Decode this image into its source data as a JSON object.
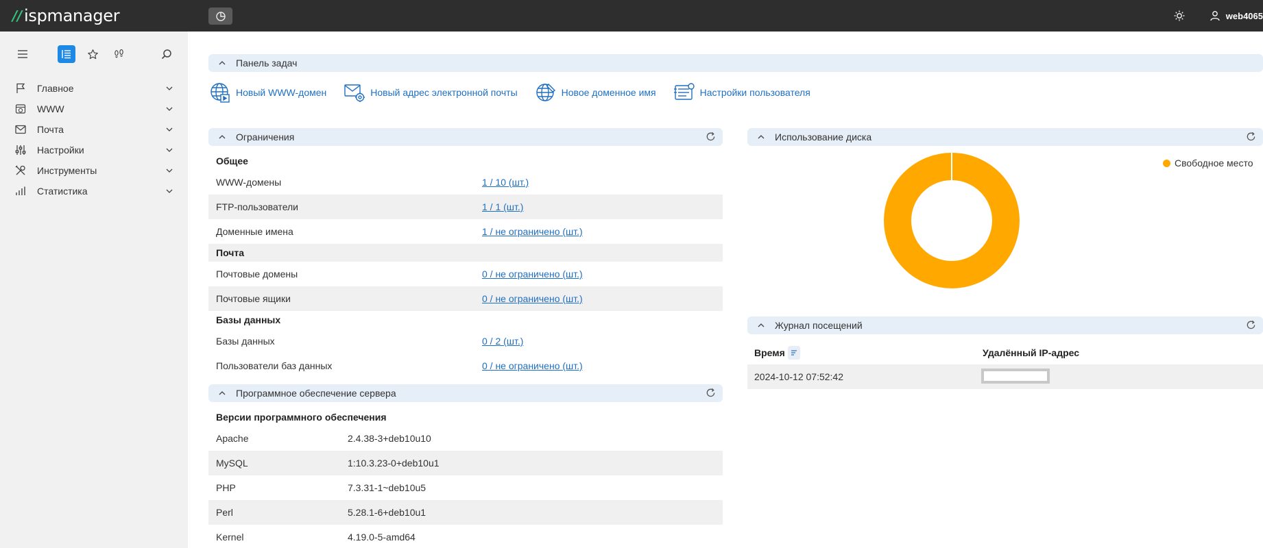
{
  "app": {
    "logo_text": "ispmanager"
  },
  "topbar": {
    "user": "web4065",
    "icons": [
      "dashboard-icon",
      "sun-icon",
      "user-icon"
    ]
  },
  "sidebar": {
    "tools": [
      "hamburger-icon",
      "list-icon",
      "star-icon",
      "footprints-icon",
      "search-icon"
    ],
    "items": [
      {
        "label": "Главное",
        "icon": "flag-icon"
      },
      {
        "label": "WWW",
        "icon": "www-icon"
      },
      {
        "label": "Почта",
        "icon": "mail-icon"
      },
      {
        "label": "Настройки",
        "icon": "sliders-icon"
      },
      {
        "label": "Инструменты",
        "icon": "tools-icon"
      },
      {
        "label": "Статистика",
        "icon": "chart-icon"
      }
    ]
  },
  "tasks": {
    "title": "Панель задач",
    "items": [
      {
        "label": "Новый WWW-домен",
        "icon": "www-domain-icon"
      },
      {
        "label": "Новый адрес электронной почты",
        "icon": "email-settings-icon"
      },
      {
        "label": "Новое доменное имя",
        "icon": "domain-name-icon"
      },
      {
        "label": "Настройки пользователя",
        "icon": "user-settings-icon"
      }
    ]
  },
  "limits": {
    "title": "Ограничения",
    "groups": [
      {
        "name": "Общее",
        "rows": [
          {
            "label": "WWW-домены",
            "value": "1 / 10 (шт.)"
          },
          {
            "label": "FTP-пользователи",
            "value": "1 / 1 (шт.)"
          },
          {
            "label": "Доменные имена",
            "value": "1 / не ограничено (шт.)"
          }
        ]
      },
      {
        "name": "Почта",
        "rows": [
          {
            "label": "Почтовые домены",
            "value": "0 / не ограничено (шт.)"
          },
          {
            "label": "Почтовые ящики",
            "value": "0 / не ограничено (шт.)"
          }
        ]
      },
      {
        "name": "Базы данных",
        "rows": [
          {
            "label": "Базы данных",
            "value": "0 / 2 (шт.)"
          },
          {
            "label": "Пользователи баз данных",
            "value": "0 / не ограничено (шт.)"
          }
        ]
      }
    ]
  },
  "software": {
    "title": "Программное обеспечение сервера",
    "group": "Версии программного обеспечения",
    "rows": [
      {
        "name": "Apache",
        "version": "2.4.38-3+deb10u10"
      },
      {
        "name": "MySQL",
        "version": "1:10.3.23-0+deb10u1"
      },
      {
        "name": "PHP",
        "version": "7.3.31-1~deb10u5"
      },
      {
        "name": "Perl",
        "version": "5.28.1-6+deb10u1"
      },
      {
        "name": "Kernel",
        "version": "4.19.0-5-amd64"
      }
    ]
  },
  "disk": {
    "title": "Использование диска",
    "legend": "Свободное место",
    "color": "#ffa800",
    "free_fraction": 1.0
  },
  "visits": {
    "title": "Журнал посещений",
    "columns": [
      "Время",
      "Удалённый IP-адрес"
    ],
    "rows": [
      {
        "time": "2024-10-12 07:52:42",
        "ip": ""
      }
    ]
  },
  "colors": {
    "accent": "#1e88e5",
    "link": "#1e6fc4",
    "panel_header": "#e6eef7",
    "topbar": "#2e2e2e"
  }
}
